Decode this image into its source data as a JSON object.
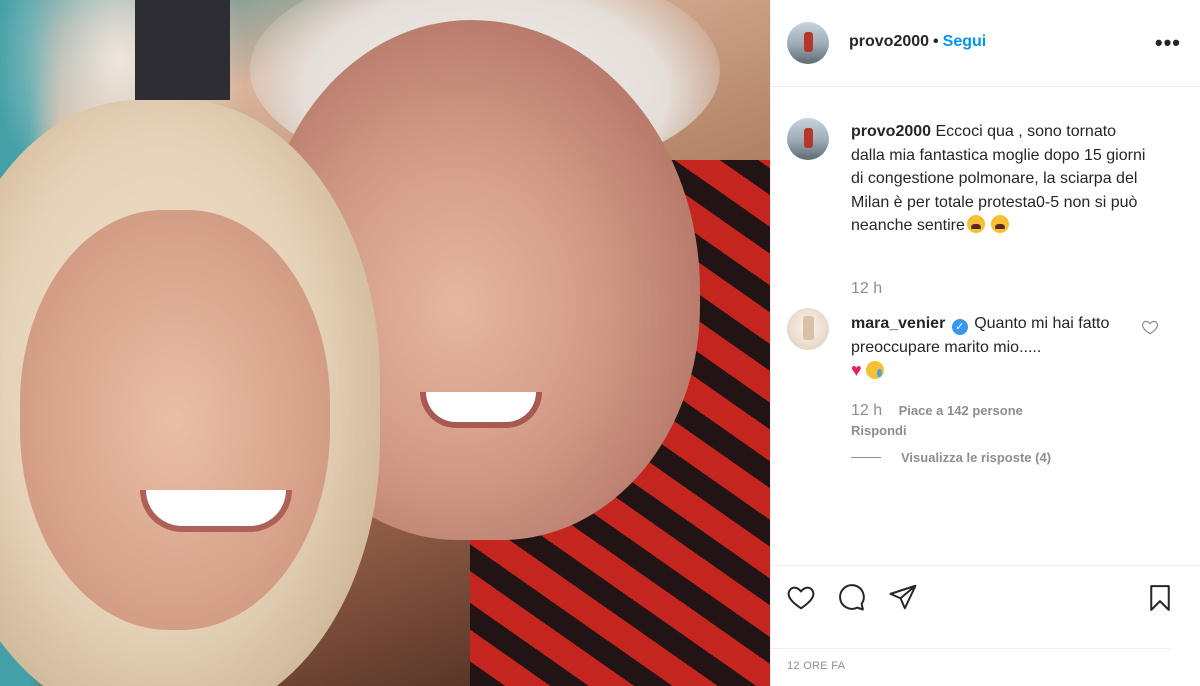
{
  "post": {
    "author": "provo2000",
    "follow_label": "Segui",
    "more_label": "•••",
    "caption_text": "Eccoci qua , sono tornato dalla mia fantastica moglie dopo 15 giorni di congestione polmonare, la sciarpa del Milan è per totale protesta0-5 non si può neanche sentire",
    "caption_time": "12 h",
    "timestamp": "12 ORE FA"
  },
  "comment": {
    "author": "mara_venier",
    "text": "Quanto mi hai fatto preoccupare marito mio.....",
    "time": "12 h",
    "likes": "Piace a 142 persone",
    "reply_label": "Rispondi",
    "view_replies": "Visualizza le risposte (4)"
  },
  "icons": {
    "like": "heart-icon",
    "comment": "comment-icon",
    "share": "paper-plane-icon",
    "save": "bookmark-icon",
    "verified": "verified-badge-icon",
    "more": "ellipsis-icon"
  },
  "colors": {
    "accent": "#0095f6",
    "verified": "#3897f0",
    "text": "#262626",
    "muted": "#8e8e8e"
  }
}
